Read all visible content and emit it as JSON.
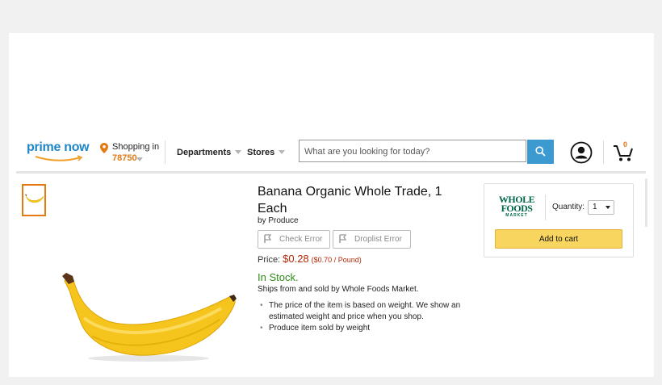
{
  "header": {
    "logo_text": "prime now",
    "location_label": "Shopping in",
    "zip": "78750",
    "nav": [
      {
        "label": "Departments"
      },
      {
        "label": "Stores"
      }
    ],
    "search_placeholder": "What are you looking for today?",
    "cart_count": "0"
  },
  "product": {
    "title": "Banana Organic Whole Trade, 1 Each",
    "byline": "by Produce",
    "error_buttons": [
      {
        "label": "Check Error"
      },
      {
        "label": "Droplist Error"
      }
    ],
    "price_label": "Price:",
    "price": "$0.28",
    "unit_price": "($0.70 / Pound)",
    "stock": "In Stock.",
    "ships": "Ships from and sold by Whole Foods Market.",
    "bullets": [
      "The price of the item is based on weight. We show an estimated weight and price when you shop.",
      "Produce item sold by weight"
    ]
  },
  "buybox": {
    "seller_logo": [
      "WHOLE",
      "FOODS",
      "MARKET"
    ],
    "quantity_label": "Quantity:",
    "quantity_value": "1",
    "add_to_cart": "Add to cart"
  },
  "colors": {
    "brand_blue": "#1f86c6",
    "accent_orange": "#e47911",
    "search_button": "#3d9ad1",
    "price_red": "#b12704",
    "stock_green": "#2e8b19",
    "add_to_cart_yellow": "#f8d55e",
    "whole_foods_green": "#00674b"
  },
  "icons": [
    "map-pin-icon",
    "search-icon",
    "account-icon",
    "cart-icon",
    "flag-icon"
  ]
}
